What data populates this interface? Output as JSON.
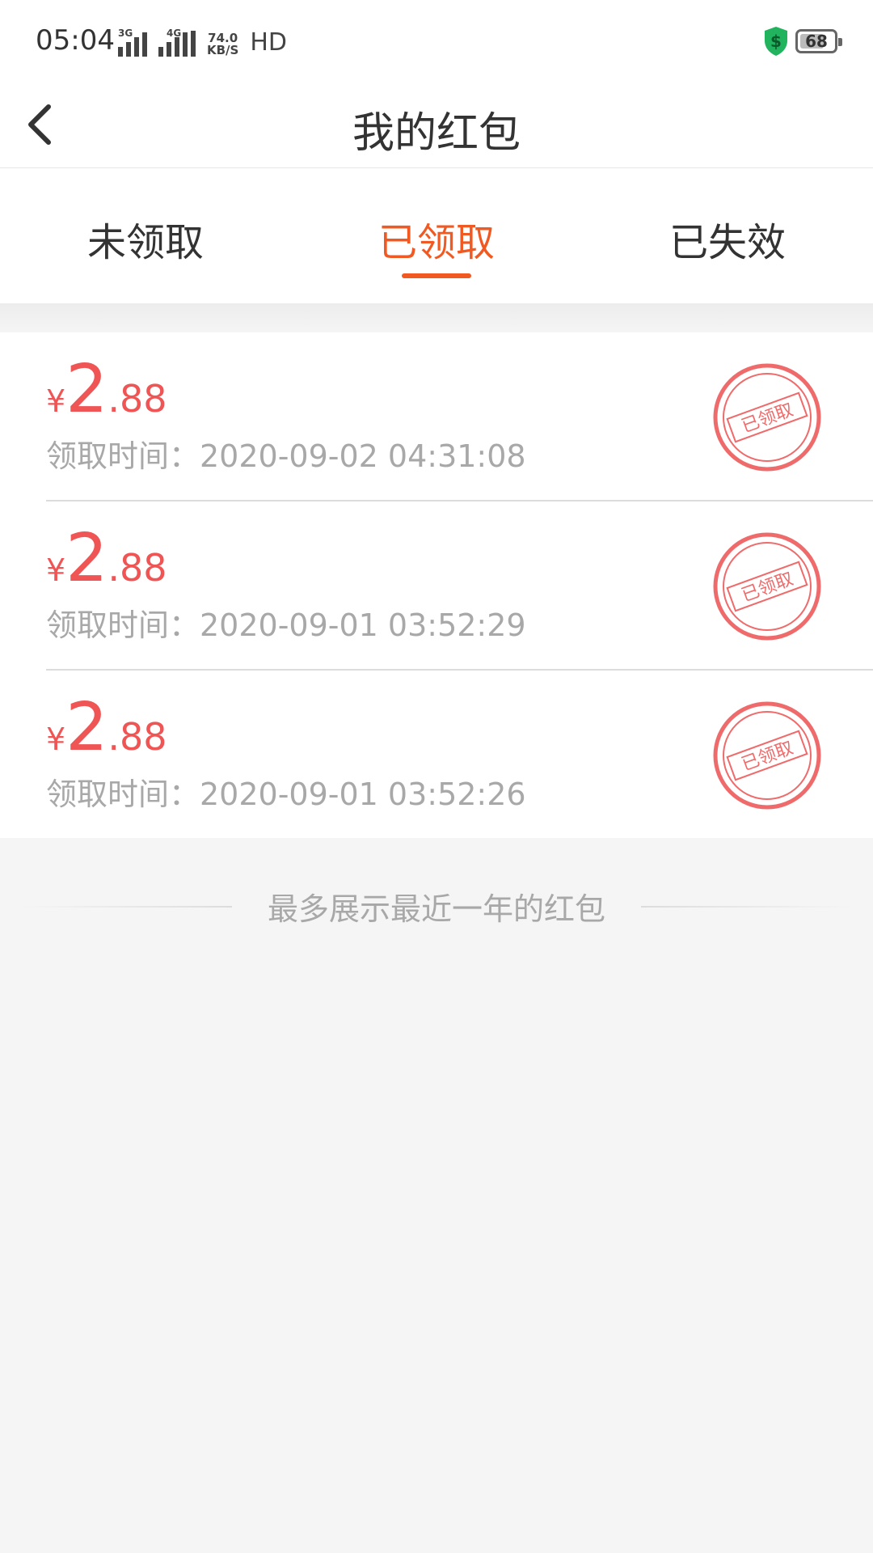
{
  "status_bar": {
    "time": "05:04",
    "net1": "3G",
    "net2": "4G",
    "speed_value": "74.0",
    "speed_unit": "KB/S",
    "hd": "HD",
    "battery": "68"
  },
  "header": {
    "title": "我的红包"
  },
  "tabs": [
    {
      "label": "未领取"
    },
    {
      "label": "已领取"
    },
    {
      "label": "已失效"
    }
  ],
  "items": [
    {
      "yen": "¥",
      "int": "2",
      "dec": ".88",
      "time": "领取时间：2020-09-02 04:31:08",
      "stamp": "已领取"
    },
    {
      "yen": "¥",
      "int": "2",
      "dec": ".88",
      "time": "领取时间：2020-09-01 03:52:29",
      "stamp": "已领取"
    },
    {
      "yen": "¥",
      "int": "2",
      "dec": ".88",
      "time": "领取时间：2020-09-01 03:52:26",
      "stamp": "已领取"
    }
  ],
  "footer_note": "最多展示最近一年的红包",
  "colors": {
    "accent": "#f05a22",
    "amount": "#f05555",
    "muted": "#a8a8a8"
  }
}
